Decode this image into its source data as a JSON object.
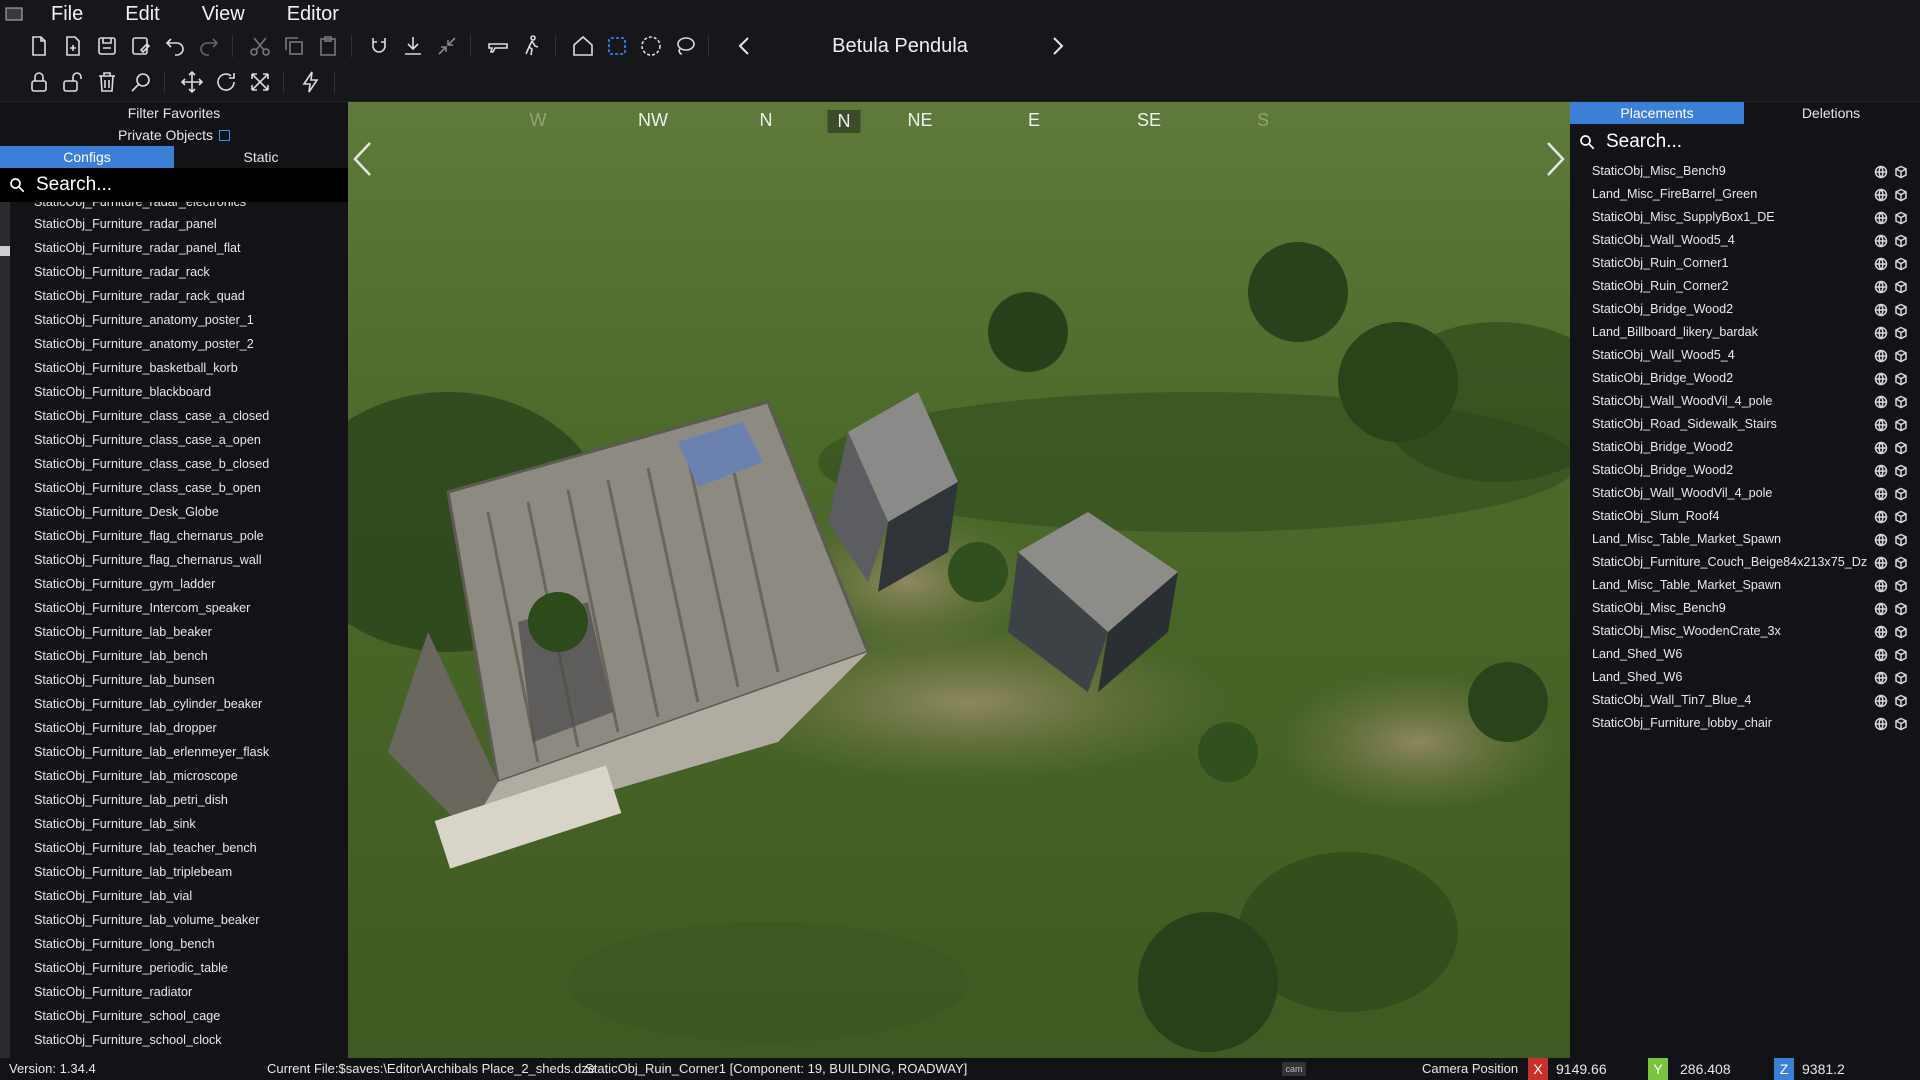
{
  "menu": {
    "items": [
      "File",
      "Edit",
      "View",
      "Editor"
    ]
  },
  "toolbar": {
    "title": "Betula Pendula"
  },
  "left_panel": {
    "filter_favorites": "Filter Favorites",
    "private_objects": "Private Objects",
    "tabs": [
      "Configs",
      "Static"
    ],
    "search_placeholder": "Search...",
    "items": [
      "StaticObj_Furniture_radar_electronics",
      "StaticObj_Furniture_radar_panel",
      "StaticObj_Furniture_radar_panel_flat",
      "StaticObj_Furniture_radar_rack",
      "StaticObj_Furniture_radar_rack_quad",
      "StaticObj_Furniture_anatomy_poster_1",
      "StaticObj_Furniture_anatomy_poster_2",
      "StaticObj_Furniture_basketball_korb",
      "StaticObj_Furniture_blackboard",
      "StaticObj_Furniture_class_case_a_closed",
      "StaticObj_Furniture_class_case_a_open",
      "StaticObj_Furniture_class_case_b_closed",
      "StaticObj_Furniture_class_case_b_open",
      "StaticObj_Furniture_Desk_Globe",
      "StaticObj_Furniture_flag_chernarus_pole",
      "StaticObj_Furniture_flag_chernarus_wall",
      "StaticObj_Furniture_gym_ladder",
      "StaticObj_Furniture_Intercom_speaker",
      "StaticObj_Furniture_lab_beaker",
      "StaticObj_Furniture_lab_bench",
      "StaticObj_Furniture_lab_bunsen",
      "StaticObj_Furniture_lab_cylinder_beaker",
      "StaticObj_Furniture_lab_dropper",
      "StaticObj_Furniture_lab_erlenmeyer_flask",
      "StaticObj_Furniture_lab_microscope",
      "StaticObj_Furniture_lab_petri_dish",
      "StaticObj_Furniture_lab_sink",
      "StaticObj_Furniture_lab_teacher_bench",
      "StaticObj_Furniture_lab_triplebeam",
      "StaticObj_Furniture_lab_vial",
      "StaticObj_Furniture_lab_volume_beaker",
      "StaticObj_Furniture_long_bench",
      "StaticObj_Furniture_periodic_table",
      "StaticObj_Furniture_radiator",
      "StaticObj_Furniture_school_cage",
      "StaticObj_Furniture_school_clock"
    ]
  },
  "compass": {
    "directions": [
      {
        "label": "W",
        "state": "faded"
      },
      {
        "label": "NW",
        "state": "normal"
      },
      {
        "label": "N",
        "state": "normal"
      },
      {
        "label": "N",
        "state": "current"
      },
      {
        "label": "NE",
        "state": "normal"
      },
      {
        "label": "E",
        "state": "normal"
      },
      {
        "label": "SE",
        "state": "normal"
      },
      {
        "label": "S",
        "state": "faded"
      }
    ]
  },
  "right_panel": {
    "tabs": [
      "Placements",
      "Deletions"
    ],
    "search_placeholder": "Search...",
    "items": [
      "StaticObj_Misc_Bench9",
      "Land_Misc_FireBarrel_Green",
      "StaticObj_Misc_SupplyBox1_DE",
      "StaticObj_Wall_Wood5_4",
      "StaticObj_Ruin_Corner1",
      "StaticObj_Ruin_Corner2",
      "StaticObj_Bridge_Wood2",
      "Land_Billboard_likery_bardak",
      "StaticObj_Wall_Wood5_4",
      "StaticObj_Bridge_Wood2",
      "StaticObj_Wall_WoodVil_4_pole",
      "StaticObj_Road_Sidewalk_Stairs",
      "StaticObj_Bridge_Wood2",
      "StaticObj_Bridge_Wood2",
      "StaticObj_Wall_WoodVil_4_pole",
      "StaticObj_Slum_Roof4",
      "Land_Misc_Table_Market_Spawn",
      "StaticObj_Furniture_Couch_Beige84x213x75_Dz",
      "Land_Misc_Table_Market_Spawn",
      "StaticObj_Misc_Bench9",
      "StaticObj_Misc_WoodenCrate_3x",
      "Land_Shed_W6",
      "Land_Shed_W6",
      "StaticObj_Wall_Tin7_Blue_4",
      "StaticObj_Furniture_lobby_chair"
    ]
  },
  "status": {
    "version": "Version:  1.34.4",
    "current_file": "Current File:$saves:\\Editor\\Archibals Place_2_sheds.dze",
    "selection": "StaticObj_Ruin_Corner1 [Component: 19, BUILDING, ROADWAY]",
    "camera_label": "Camera Position",
    "x_label": "X",
    "x": "9149.66",
    "y_label": "Y",
    "y": "286.408",
    "z_label": "Z",
    "z": "9381.2"
  },
  "colors": {
    "accent": "#3c7fd6",
    "axis_x": "#c8302c",
    "axis_y": "#7cc241",
    "axis_z": "#3c7fd6"
  }
}
